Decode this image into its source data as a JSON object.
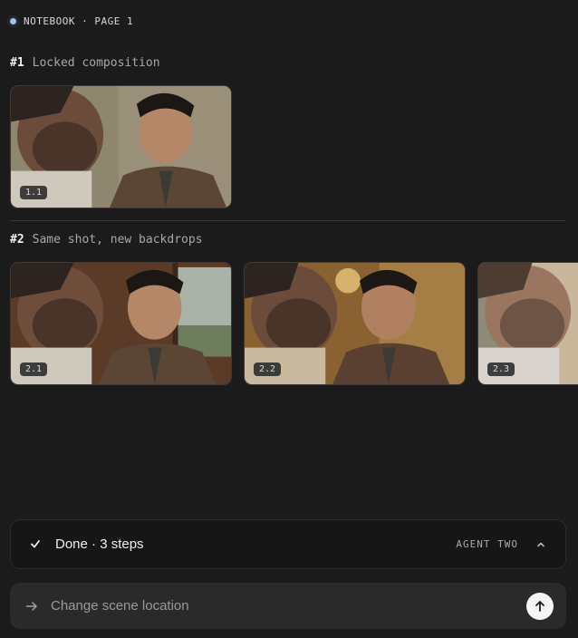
{
  "header": {
    "title": "NOTEBOOK · PAGE 1"
  },
  "sections": [
    {
      "number": "#1",
      "label": "Locked composition",
      "thumbs": [
        {
          "badge": "1.1",
          "backdrop": "neutral-beige"
        }
      ]
    },
    {
      "number": "#2",
      "label": "Same shot, new backdrops",
      "thumbs": [
        {
          "badge": "2.1",
          "backdrop": "train-window"
        },
        {
          "badge": "2.2",
          "backdrop": "gilded-hall"
        },
        {
          "badge": "2.3",
          "backdrop": "bright-exterior"
        }
      ]
    }
  ],
  "status": {
    "text": "Done · 3 steps",
    "agent": "AGENT TWO"
  },
  "input": {
    "placeholder": "Change scene location",
    "value": ""
  },
  "colors": {
    "background": "#1b1b1c",
    "accent_dot": "#9ec3f2",
    "send_button": "#f4f4f4"
  }
}
